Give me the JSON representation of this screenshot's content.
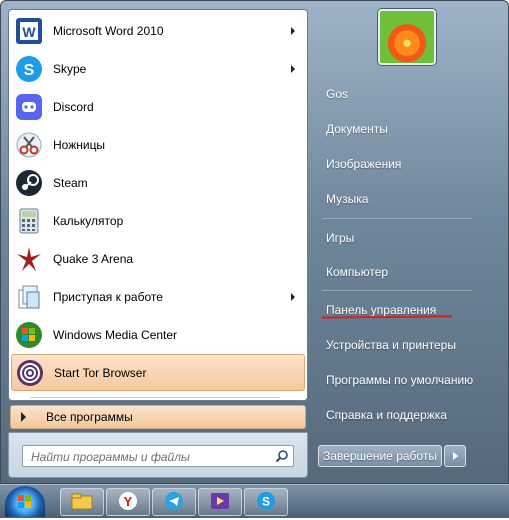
{
  "programs": [
    {
      "label": "Microsoft Word 2010",
      "icon": "word-icon",
      "submenu": true
    },
    {
      "label": "Skype",
      "icon": "skype-icon",
      "submenu": true
    },
    {
      "label": "Discord",
      "icon": "discord-icon",
      "submenu": false
    },
    {
      "label": "Ножницы",
      "icon": "scissors-icon",
      "submenu": false
    },
    {
      "label": "Steam",
      "icon": "steam-icon",
      "submenu": false
    },
    {
      "label": "Калькулятор",
      "icon": "calculator-icon",
      "submenu": false
    },
    {
      "label": "Quake 3 Arena",
      "icon": "quake-icon",
      "submenu": false
    },
    {
      "label": "Приступая к работе",
      "icon": "getting-started-icon",
      "submenu": true
    },
    {
      "label": "Windows Media Center",
      "icon": "media-center-icon",
      "submenu": false
    },
    {
      "label": "Start Tor Browser",
      "icon": "tor-icon",
      "submenu": false,
      "highlighted": true
    }
  ],
  "all_programs": "Все программы",
  "search": {
    "placeholder": "Найти программы и файлы"
  },
  "right_items": [
    {
      "label": "Gos"
    },
    {
      "label": "Документы"
    },
    {
      "label": "Изображения"
    },
    {
      "label": "Музыка"
    },
    {
      "label": "Игры"
    },
    {
      "label": "Компьютер"
    },
    {
      "label": "Панель управления"
    },
    {
      "label": "Устройства и принтеры"
    },
    {
      "label": "Программы по умолчанию"
    },
    {
      "label": "Справка и поддержка"
    }
  ],
  "shutdown": {
    "label": "Завершение работы"
  },
  "user": {
    "avatar": "flower-avatar"
  },
  "taskbar": {
    "buttons": [
      "explorer-icon",
      "yandex-browser-icon",
      "telegram-icon",
      "media-player-icon",
      "skype-icon"
    ]
  },
  "colors": {
    "highlight": "#f6c99e",
    "underline": "#d62020",
    "menu_blue": "#6f879c"
  }
}
